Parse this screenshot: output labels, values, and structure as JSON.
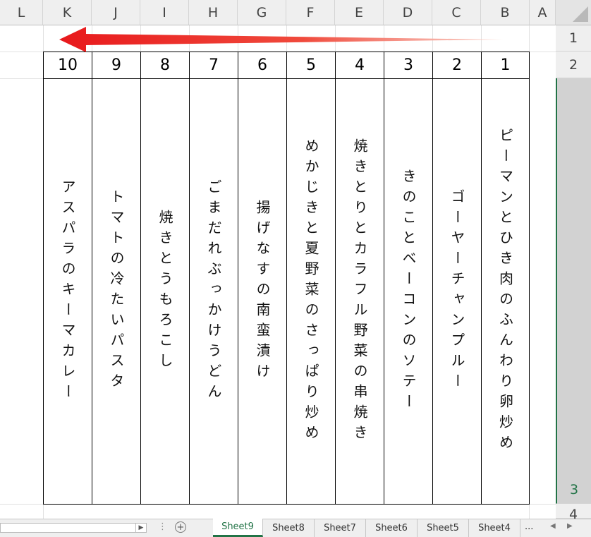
{
  "sheet": {
    "columns": [
      "L",
      "K",
      "J",
      "I",
      "H",
      "G",
      "F",
      "E",
      "D",
      "C",
      "B",
      "A"
    ],
    "rows": [
      "1",
      "2",
      "3",
      "4"
    ]
  },
  "table": {
    "numbers": [
      "10",
      "9",
      "8",
      "7",
      "6",
      "5",
      "4",
      "3",
      "2",
      "1"
    ],
    "dishes": [
      "アスパラのキーマカレー",
      "トマトの冷たいパスタ",
      "焼きとうもろこし",
      "ごまだれぶっかけうどん",
      "揚げなすの南蛮漬け",
      "めかじきと夏野菜のさっぱり炒め",
      "焼きとりとカラフル野菜の串焼き",
      "きのことベーコンのソテー",
      "ゴーヤーチャンプルー",
      "ピーマンとひき肉のふんわり卵炒め"
    ]
  },
  "annotation": {
    "arrow_color": "#e8191c",
    "arrow_direction": "left"
  },
  "tabs": {
    "sheets": [
      "Sheet9",
      "Sheet8",
      "Sheet7",
      "Sheet6",
      "Sheet5",
      "Sheet4"
    ],
    "active": "Sheet9",
    "more": "..."
  },
  "colors": {
    "accent": "#217346",
    "header_bg": "#efefef"
  }
}
